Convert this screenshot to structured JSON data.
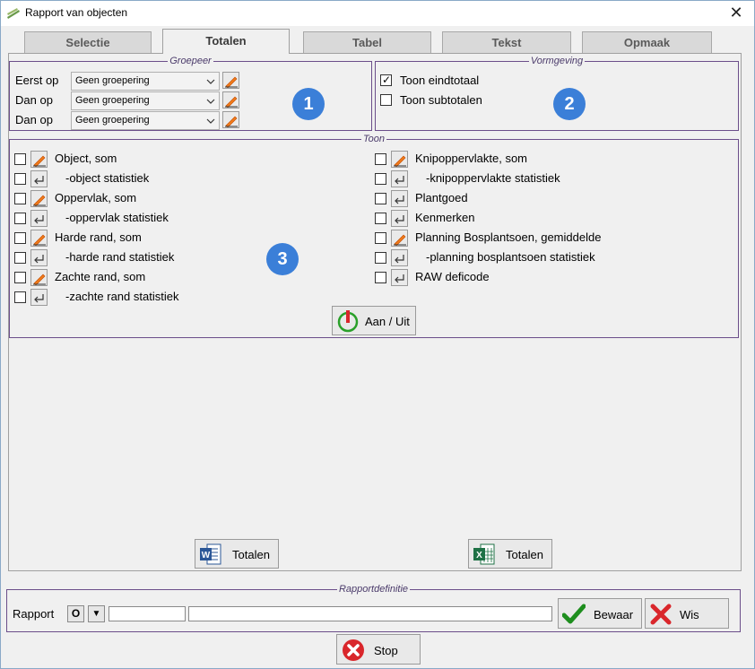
{
  "window": {
    "title": "Rapport van objecten",
    "close_glyph": "✕"
  },
  "tabs": [
    {
      "label": "Selectie",
      "active": false
    },
    {
      "label": "Totalen",
      "active": true
    },
    {
      "label": "Tabel",
      "active": false
    },
    {
      "label": "Tekst",
      "active": false
    },
    {
      "label": "Opmaak",
      "active": false
    }
  ],
  "groepeer": {
    "legend": "Groepeer",
    "rows": [
      {
        "label": "Eerst op",
        "value": "Geen groepering"
      },
      {
        "label": "Dan op",
        "value": "Geen groepering"
      },
      {
        "label": "Dan op",
        "value": "Geen groepering"
      }
    ],
    "badge": "1"
  },
  "vormgeving": {
    "legend": "Vormgeving",
    "items": [
      {
        "label": "Toon eindtotaal",
        "checked": true
      },
      {
        "label": "Toon subtotalen",
        "checked": false
      }
    ],
    "badge": "2"
  },
  "toon": {
    "legend": "Toon",
    "badge": "3",
    "left": [
      {
        "label": "Object, som",
        "icon": "pencil-icon"
      },
      {
        "label": "-object statistiek",
        "icon": "enter-icon"
      },
      {
        "label": "Oppervlak, som",
        "icon": "pencil-icon"
      },
      {
        "label": "-oppervlak statistiek",
        "icon": "enter-icon"
      },
      {
        "label": "Harde rand, som",
        "icon": "pencil-icon"
      },
      {
        "label": "-harde rand statistiek",
        "icon": "enter-icon"
      },
      {
        "label": "Zachte rand, som",
        "icon": "pencil-icon"
      },
      {
        "label": "-zachte rand statistiek",
        "icon": "enter-icon"
      }
    ],
    "right": [
      {
        "label": "Knipoppervlakte, som",
        "icon": "pencil-icon"
      },
      {
        "label": "-knipoppervlakte statistiek",
        "icon": "enter-icon"
      },
      {
        "label": "Plantgoed",
        "icon": "enter-icon"
      },
      {
        "label": "Kenmerken",
        "icon": "enter-icon"
      },
      {
        "label": "Planning Bosplantsoen, gemiddelde",
        "icon": "pencil-icon"
      },
      {
        "label": "-planning bosplantsoen statistiek",
        "icon": "enter-icon"
      },
      {
        "label": "RAW deficode",
        "icon": "enter-icon"
      }
    ],
    "toggle_button": "Aan / Uit"
  },
  "export": {
    "word_label": "Totalen",
    "excel_label": "Totalen"
  },
  "rapportdefinitie": {
    "legend": "Rapportdefinitie",
    "label": "Rapport",
    "open_glyph": "O",
    "dropdown_glyph": "▼",
    "code_value": "",
    "name_value": "",
    "save_label": "Bewaar",
    "clear_label": "Wis"
  },
  "stop_label": "Stop",
  "colors": {
    "accent_badge": "#3b7fd8",
    "group_border": "#6b4e8a",
    "check_green": "#1e8e1e",
    "x_red": "#d9262b"
  }
}
